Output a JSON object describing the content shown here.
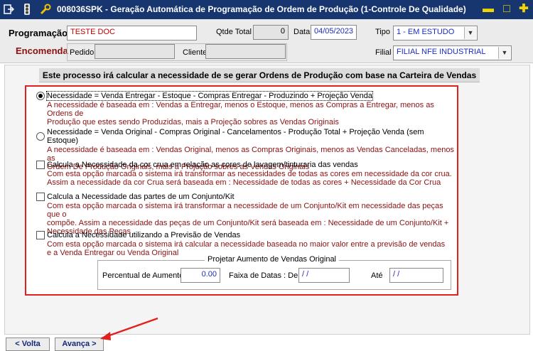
{
  "window": {
    "title": "008036SPK - Geração Automática de Programação de Ordem de Produção (1-Controle De Qualidade)",
    "accent_color": "#17366f",
    "icons": [
      "exit-icon",
      "traffic-light-icon",
      "wrench-icon"
    ],
    "controls": {
      "minimize": "▬",
      "restore": "□",
      "add": "✚"
    }
  },
  "header": {
    "programacao_label": "Programação",
    "programacao_value": "TESTE DOC",
    "qtde_total_label": "Qtde Total",
    "qtde_total_value": "0",
    "data_label": "Data",
    "data_value": "04/05/2023",
    "tipo_label": "Tipo",
    "tipo_value": "1 - EM ESTUDO",
    "encomenda_label": "Encomenda",
    "pedido_label": "Pedido",
    "pedido_value": "",
    "cliente_label": "Cliente",
    "cliente_value": "",
    "filial_label": "Filial",
    "filial_value": "FILIAL NFE INDUSTRIAL"
  },
  "main": {
    "banner": "Este processo irá calcular a necessidade de se gerar Ordens de Produção com base na Carteira de Vendas",
    "options": [
      {
        "control": "radio",
        "selected": true,
        "label": "Necessidade = Venda Entregar - Estoque - Compras Entregar - Produzindo + Projeção Venda",
        "desc_lines": [
          "A necessidade é baseada em : Vendas a Entregar, menos o Estoque, menos as Compras a Entregar, menos as Ordens de",
          "Produção que estes sendo Produzidas, mais a Projeção sobres as Vendas Originais"
        ]
      },
      {
        "control": "radio",
        "selected": false,
        "label": "Necessidade = Venda Original - Compras Original - Cancelamentos - Produção Total + Projeção Venda (sem Estoque)",
        "desc_lines": [
          "A necessidade é baseada em : Vendas Original, menos as Compras Originais, menos as Vendas Canceladas, menos as",
          "Ordem De Produção Originais, mais a Projeção sobres as Vendas Originais"
        ]
      },
      {
        "control": "checkbox",
        "checked": false,
        "label": "Calcula a Necessidade da cor crua em relação as cores de lavagem/tinturaria das vendas",
        "desc_lines": [
          "Com esta opção marcada o sistema irá transformar as necessidades de todas as cores em necessidade da cor crua.",
          "Assim a necessidade da cor Crua será baseada em : Necessidade de todas as cores + Necessidade da Cor Crua"
        ]
      },
      {
        "control": "checkbox",
        "checked": false,
        "label": "Calcula a Necessidade das partes de um Conjunto/Kit",
        "desc_lines": [
          "Com esta opção marcada o sistema irá transformar a necessidade de um Conjunto/Kit em necessidade das peças que o",
          "compõe. Assim a necessidade das peças de um Conjunto/Kit será baseada em : Necessidade de um Conjunto/Kit +",
          "Necessidade das Peças"
        ]
      },
      {
        "control": "checkbox",
        "checked": false,
        "label": "Calcula a Necessidade utilizando a Previsão de Vendas",
        "desc_lines": [
          "Com esta opção marcada o sistema irá calcular a necessidade baseada no maior valor entre a previsão de vendas",
          "e a Venda Entregar ou Venda Original"
        ]
      }
    ],
    "projection_group": {
      "title": "Projetar Aumento de Vendas Original",
      "percentual_label": "Percentual de Aumento",
      "percentual_value": "0.00",
      "faixa_label": "Faixa de Datas : De",
      "de_value": " / /",
      "ate_label": "Até",
      "ate_value": " / /"
    }
  },
  "footer": {
    "voltar_label": "< Volta",
    "avancar_label": "Avança >"
  },
  "annotation_color": "#e12020"
}
